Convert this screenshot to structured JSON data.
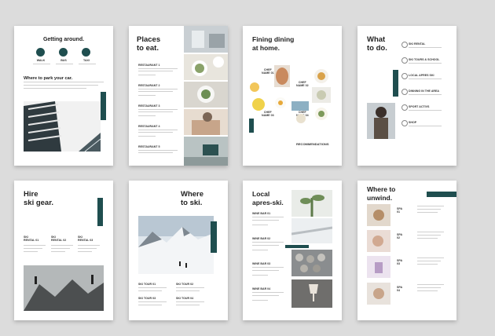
{
  "pages": {
    "p1": {
      "title": "Getting around.",
      "icons": [
        "walk-icon",
        "bus-icon",
        "car-icon"
      ],
      "icon_labels": [
        "WALK",
        "BUS",
        "TAXI"
      ],
      "subtitle": "Where to park your car."
    },
    "p2": {
      "title": "Places\nto eat.",
      "items": [
        "RESTAURANT 1",
        "RESTAURANT 2",
        "RESTAURANT 3",
        "RESTAURANT 4",
        "RESTAURANT 5"
      ]
    },
    "p3": {
      "title": "Fining dining\nat home.",
      "labels": [
        "CHEF\nNAME 01",
        "CHEF\nNAME 02",
        "CHEF\nNAME 03",
        "CHEF\nNAME 04"
      ],
      "footer": "RECOMMENDATIONS"
    },
    "p4": {
      "title": "What\nto do.",
      "items": [
        "SKI RENTAL",
        "SKI TOURS & SCHOOL",
        "LOCAL APRES SKI",
        "DINNING IN THE AREA",
        "SPORT ACTIVS",
        "SHOP"
      ]
    },
    "p5": {
      "title": "Hire\nski gear.",
      "cols": [
        "SKI\nRENTAL 01",
        "SKI\nRENTAL 02",
        "SKI\nRENTAL 03"
      ]
    },
    "p6": {
      "title": "Where\nto ski.",
      "tours": [
        "SKI TOUR 01",
        "SKI TOUR 02",
        "SKI TOUR 03",
        "SKI TOUR 04"
      ]
    },
    "p7": {
      "title": "Local\napres-ski.",
      "bars": [
        "WINE BAR 01",
        "WINE BAR 02",
        "WINE BAR 03",
        "WINE BAR 04"
      ]
    },
    "p8": {
      "title": "Where to\nunwind.",
      "spas": [
        "SPA\n01",
        "SPA\n02",
        "SPA\n03",
        "SPA\n04"
      ]
    }
  },
  "colors": {
    "accent": "#1f4e4f",
    "background": "#dcdcdc"
  }
}
